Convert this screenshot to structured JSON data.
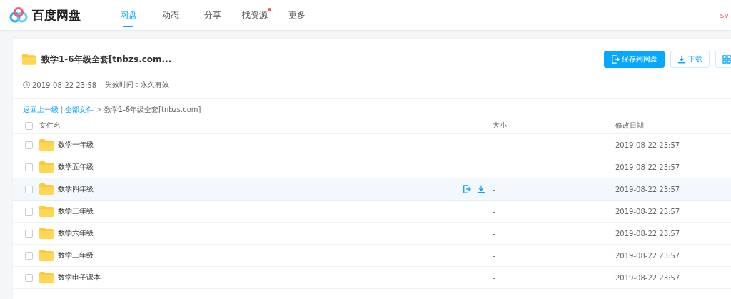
{
  "header": {
    "logo": "百度网盘",
    "nav": [
      {
        "label": "网盘",
        "selected": true,
        "dot": false
      },
      {
        "label": "动态",
        "selected": false,
        "dot": false
      },
      {
        "label": "分享",
        "selected": false,
        "dot": false
      },
      {
        "label": "找资源",
        "selected": false,
        "dot": true
      },
      {
        "label": "更多",
        "selected": false,
        "dot": false
      }
    ],
    "user": "sv"
  },
  "share": {
    "title": "数学1-6年级全套[tnbzs.com...",
    "time": "2019-08-22 23:58",
    "expiry": "失效时间：永久有效",
    "buttons": [
      {
        "kind": "save",
        "label": "保存到网盘"
      },
      {
        "kind": "download",
        "label": "下载"
      },
      {
        "kind": "more"
      }
    ]
  },
  "breadcrumb": {
    "back": "返回上一级",
    "divider": "|",
    "all": "全部文件",
    "arrow": ">",
    "current": "数学1-6年级全套[tnbzs.com]"
  },
  "table": {
    "select_all_checked": false,
    "columns": [
      "文件名",
      "大小",
      "修改日期"
    ],
    "rows": [
      {
        "name": "数学一年级",
        "size": "-",
        "date": "2019-08-22 23:57",
        "hovered": false,
        "checked": false
      },
      {
        "name": "数学五年级",
        "size": "-",
        "date": "2019-08-22 23:57",
        "hovered": false,
        "checked": false
      },
      {
        "name": "数学四年级",
        "size": "-",
        "date": "2019-08-22 23:57",
        "hovered": true,
        "checked": false
      },
      {
        "name": "数学三年级",
        "size": "-",
        "date": "2019-08-22 23:57",
        "hovered": false,
        "checked": false
      },
      {
        "name": "数学六年级",
        "size": "-",
        "date": "2019-08-22 23:57",
        "hovered": false,
        "checked": false
      },
      {
        "name": "数学二年级",
        "size": "-",
        "date": "2019-08-22 23:57",
        "hovered": false,
        "checked": false
      },
      {
        "name": "数学电子课本",
        "size": "-",
        "date": "2019-08-22 23:57",
        "hovered": false,
        "checked": false
      }
    ]
  }
}
